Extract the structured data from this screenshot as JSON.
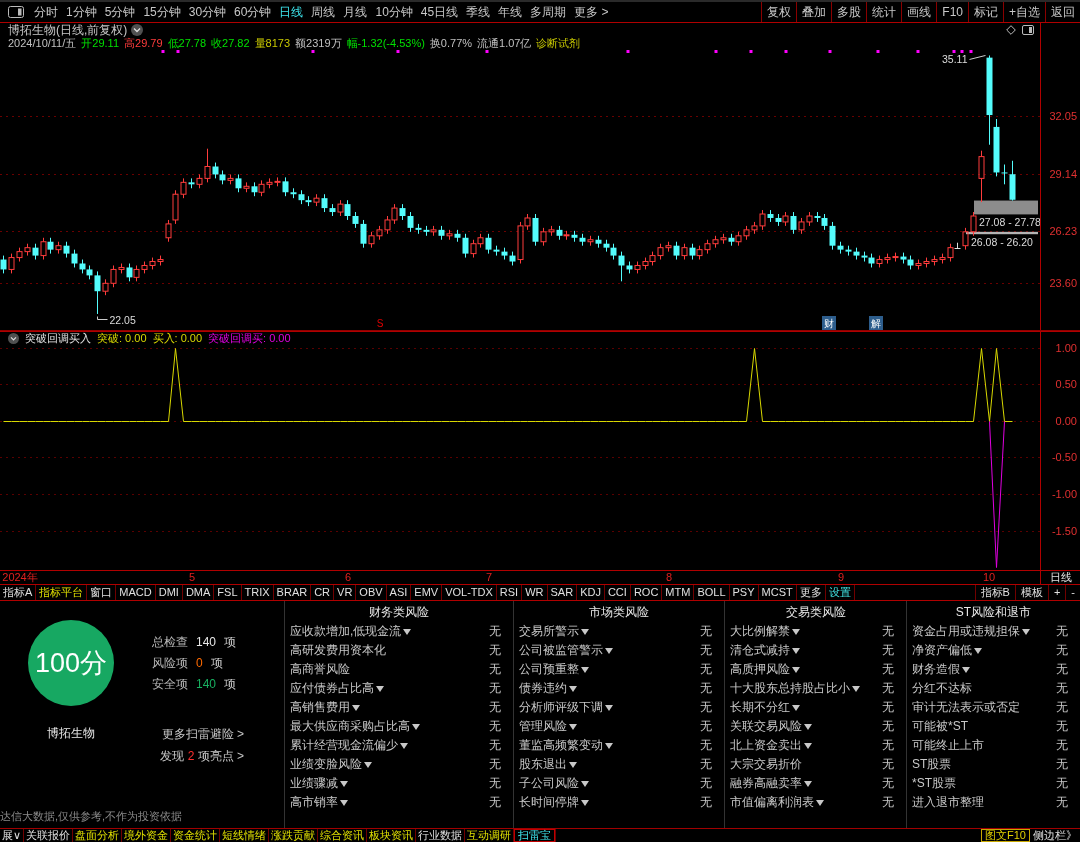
{
  "toolbar": {
    "periods": [
      {
        "label": "分时",
        "selected": false
      },
      {
        "label": "1分钟",
        "selected": false
      },
      {
        "label": "5分钟",
        "selected": false
      },
      {
        "label": "15分钟",
        "selected": false
      },
      {
        "label": "30分钟",
        "selected": false
      },
      {
        "label": "60分钟",
        "selected": false
      },
      {
        "label": "日线",
        "selected": true
      },
      {
        "label": "周线",
        "selected": false
      },
      {
        "label": "月线",
        "selected": false
      },
      {
        "label": "10分钟",
        "selected": false
      },
      {
        "label": "45日线",
        "selected": false
      },
      {
        "label": "季线",
        "selected": false
      },
      {
        "label": "年线",
        "selected": false
      },
      {
        "label": "多周期",
        "selected": false
      },
      {
        "label": "更多 >",
        "selected": false
      }
    ],
    "buttons": [
      "复权",
      "叠加",
      "多股",
      "统计",
      "画线",
      "F10",
      "标记",
      "+自选",
      "返回"
    ]
  },
  "quote": {
    "title": "博拓生物(日线,前复权)",
    "fields": [
      {
        "text": "2024/10/11/五",
        "kind": "plain"
      },
      {
        "text": "开29.11",
        "kind": "down"
      },
      {
        "text": "高29.79",
        "kind": "up"
      },
      {
        "text": "低27.78",
        "kind": "down"
      },
      {
        "text": "收27.82",
        "kind": "down"
      },
      {
        "text": "量8173",
        "kind": "volume"
      },
      {
        "text": "额2319万",
        "kind": "plain"
      },
      {
        "text": "幅-1.32(-4.53%)",
        "kind": "down"
      },
      {
        "text": "换0.77%",
        "kind": "plain"
      },
      {
        "text": "流通1.07亿",
        "kind": "plain"
      },
      {
        "text": "诊断试剂",
        "kind": "sector"
      }
    ]
  },
  "price_chart": {
    "chart_data": {
      "type": "candlestick",
      "grid": true,
      "categories": [
        null,
        null,
        null,
        null,
        null,
        null,
        null,
        null,
        null,
        null,
        null,
        null,
        null,
        null,
        null,
        null,
        null,
        null,
        null,
        null,
        null,
        null,
        null,
        null,
        null,
        null,
        null,
        null,
        null,
        null,
        null,
        null,
        null,
        null,
        null,
        null,
        null,
        null,
        null,
        null,
        null,
        null,
        null,
        null,
        null,
        null,
        null,
        null,
        null,
        null,
        null,
        null,
        null,
        null,
        null,
        null,
        null,
        null,
        null,
        null,
        null,
        null,
        null,
        null,
        null,
        null,
        null,
        null,
        null,
        null,
        null,
        null,
        null,
        null,
        null,
        null,
        null,
        null,
        null,
        null,
        null,
        null,
        null,
        null,
        null,
        null,
        null,
        null,
        null,
        null,
        null,
        null,
        null,
        null,
        null,
        null,
        null,
        null,
        null,
        null,
        null,
        null,
        null,
        null,
        null,
        null,
        null,
        null,
        null,
        null,
        null,
        null,
        null,
        null,
        null,
        null,
        null,
        null,
        null,
        null,
        null,
        null,
        null,
        null,
        null,
        null,
        null,
        null,
        null,
        null,
        null,
        null,
        null
      ],
      "ohlc": [
        [
          24.8,
          25.0,
          24.1,
          24.3
        ],
        [
          24.3,
          25.1,
          24.1,
          24.9
        ],
        [
          24.9,
          25.4,
          24.7,
          25.2
        ],
        [
          25.2,
          25.6,
          25.0,
          25.4
        ],
        [
          25.4,
          25.6,
          24.8,
          25.0
        ],
        [
          25.0,
          25.9,
          24.8,
          25.7
        ],
        [
          25.7,
          25.9,
          25.1,
          25.3
        ],
        [
          25.3,
          25.7,
          25.1,
          25.5
        ],
        [
          25.5,
          25.7,
          24.9,
          25.1
        ],
        [
          25.1,
          25.3,
          24.4,
          24.6
        ],
        [
          24.6,
          24.8,
          24.1,
          24.3
        ],
        [
          24.3,
          24.5,
          23.8,
          24.0
        ],
        [
          24.0,
          24.2,
          22.05,
          23.2
        ],
        [
          23.2,
          23.8,
          23.0,
          23.6
        ],
        [
          23.6,
          24.5,
          23.4,
          24.3
        ],
        [
          24.3,
          24.6,
          24.1,
          24.4
        ],
        [
          24.4,
          24.6,
          23.7,
          23.9
        ],
        [
          23.9,
          24.5,
          23.7,
          24.3
        ],
        [
          24.3,
          24.7,
          24.1,
          24.5
        ],
        [
          24.5,
          24.9,
          24.3,
          24.7
        ],
        [
          24.7,
          25.0,
          24.5,
          24.8
        ],
        [
          25.9,
          26.8,
          25.7,
          26.6
        ],
        [
          26.8,
          28.3,
          26.6,
          28.1
        ],
        [
          28.1,
          28.9,
          27.9,
          28.7
        ],
        [
          28.7,
          28.9,
          28.4,
          28.6
        ],
        [
          28.6,
          29.1,
          28.4,
          28.9
        ],
        [
          28.9,
          30.4,
          28.7,
          29.5
        ],
        [
          29.5,
          29.7,
          28.9,
          29.1
        ],
        [
          29.1,
          29.3,
          28.6,
          28.8
        ],
        [
          28.8,
          29.1,
          28.6,
          28.9
        ],
        [
          28.9,
          29.1,
          28.2,
          28.4
        ],
        [
          28.4,
          28.7,
          28.2,
          28.5
        ],
        [
          28.5,
          28.7,
          28.0,
          28.2
        ],
        [
          28.2,
          28.8,
          28.0,
          28.6
        ],
        [
          28.6,
          28.9,
          28.4,
          28.7
        ],
        [
          28.7,
          28.95,
          28.5,
          28.75
        ],
        [
          28.75,
          28.95,
          28.0,
          28.2
        ],
        [
          28.2,
          28.4,
          27.9,
          28.1
        ],
        [
          28.1,
          28.3,
          27.6,
          27.8
        ],
        [
          27.8,
          28.0,
          27.5,
          27.7
        ],
        [
          27.7,
          28.1,
          27.5,
          27.9
        ],
        [
          27.9,
          28.1,
          27.2,
          27.4
        ],
        [
          27.4,
          27.6,
          27.0,
          27.2
        ],
        [
          27.2,
          27.8,
          27.0,
          27.6
        ],
        [
          27.6,
          27.8,
          26.8,
          27.0
        ],
        [
          27.0,
          27.2,
          26.4,
          26.6
        ],
        [
          26.6,
          26.8,
          25.4,
          25.6
        ],
        [
          25.6,
          26.2,
          25.4,
          26.0
        ],
        [
          26.0,
          26.5,
          25.8,
          26.3
        ],
        [
          26.3,
          27.0,
          26.1,
          26.8
        ],
        [
          26.8,
          27.6,
          26.6,
          27.4
        ],
        [
          27.4,
          27.6,
          26.8,
          27.0
        ],
        [
          27.0,
          27.2,
          26.2,
          26.4
        ],
        [
          26.4,
          26.6,
          26.1,
          26.3
        ],
        [
          26.3,
          26.5,
          26.0,
          26.2
        ],
        [
          26.2,
          26.5,
          26.0,
          26.3
        ],
        [
          26.3,
          26.5,
          25.8,
          26.0
        ],
        [
          26.0,
          26.3,
          25.8,
          26.1
        ],
        [
          26.1,
          26.3,
          25.7,
          25.9
        ],
        [
          25.9,
          26.1,
          24.9,
          25.1
        ],
        [
          25.1,
          25.8,
          24.9,
          25.6
        ],
        [
          25.6,
          26.1,
          25.4,
          25.9
        ],
        [
          25.9,
          26.1,
          25.1,
          25.3
        ],
        [
          25.3,
          25.5,
          25.0,
          25.2
        ],
        [
          25.2,
          25.4,
          24.8,
          25.0
        ],
        [
          25.0,
          25.2,
          24.5,
          24.7
        ],
        [
          24.8,
          26.7,
          24.6,
          26.5
        ],
        [
          26.5,
          27.1,
          26.3,
          26.9
        ],
        [
          26.9,
          27.1,
          25.5,
          25.7
        ],
        [
          25.7,
          26.4,
          25.5,
          26.2
        ],
        [
          26.2,
          26.5,
          26.0,
          26.3
        ],
        [
          26.3,
          26.5,
          25.8,
          26.0
        ],
        [
          26.0,
          26.25,
          25.8,
          26.05
        ],
        [
          26.05,
          26.25,
          25.7,
          25.9
        ],
        [
          25.9,
          26.1,
          25.5,
          25.7
        ],
        [
          25.7,
          26.0,
          25.5,
          25.8
        ],
        [
          25.8,
          26.0,
          25.4,
          25.6
        ],
        [
          25.6,
          25.8,
          25.2,
          25.4
        ],
        [
          25.4,
          25.6,
          24.8,
          25.0
        ],
        [
          25.0,
          25.2,
          23.7,
          24.5
        ],
        [
          24.5,
          24.7,
          24.1,
          24.3
        ],
        [
          24.3,
          24.7,
          24.1,
          24.5
        ],
        [
          24.5,
          24.9,
          24.3,
          24.7
        ],
        [
          24.7,
          25.2,
          24.5,
          25.0
        ],
        [
          25.0,
          25.6,
          24.8,
          25.4
        ],
        [
          25.4,
          25.7,
          25.2,
          25.5
        ],
        [
          25.5,
          25.7,
          24.8,
          25.0
        ],
        [
          25.0,
          25.6,
          24.8,
          25.4
        ],
        [
          25.4,
          25.6,
          24.8,
          25.0
        ],
        [
          25.0,
          25.5,
          24.8,
          25.3
        ],
        [
          25.3,
          25.8,
          25.1,
          25.6
        ],
        [
          25.6,
          26.0,
          25.4,
          25.8
        ],
        [
          25.8,
          26.1,
          25.6,
          25.9
        ],
        [
          25.9,
          26.1,
          25.5,
          25.7
        ],
        [
          25.7,
          26.2,
          25.5,
          26.0
        ],
        [
          26.0,
          26.5,
          25.8,
          26.3
        ],
        [
          26.3,
          26.7,
          26.1,
          26.5
        ],
        [
          26.5,
          27.3,
          26.3,
          27.1
        ],
        [
          27.1,
          27.3,
          26.7,
          26.9
        ],
        [
          26.9,
          27.1,
          26.5,
          26.7
        ],
        [
          26.7,
          27.2,
          26.5,
          27.0
        ],
        [
          27.0,
          27.2,
          26.1,
          26.3
        ],
        [
          26.3,
          26.9,
          26.1,
          26.7
        ],
        [
          26.7,
          27.2,
          26.5,
          27.0
        ],
        [
          27.0,
          27.2,
          26.7,
          26.9
        ],
        [
          26.9,
          27.1,
          26.3,
          26.5
        ],
        [
          26.5,
          26.7,
          25.3,
          25.5
        ],
        [
          25.5,
          25.7,
          25.1,
          25.3
        ],
        [
          25.3,
          25.5,
          25.0,
          25.2
        ],
        [
          25.2,
          25.4,
          24.8,
          25.0
        ],
        [
          25.0,
          25.2,
          24.7,
          24.9
        ],
        [
          24.9,
          25.1,
          24.4,
          24.6
        ],
        [
          24.6,
          25.0,
          24.4,
          24.8
        ],
        [
          24.8,
          25.1,
          24.6,
          24.9
        ],
        [
          24.9,
          25.15,
          24.7,
          24.95
        ],
        [
          24.95,
          25.15,
          24.6,
          24.8
        ],
        [
          24.8,
          25.0,
          24.3,
          24.5
        ],
        [
          24.5,
          24.8,
          24.3,
          24.6
        ],
        [
          24.6,
          24.9,
          24.4,
          24.7
        ],
        [
          24.7,
          25.0,
          24.5,
          24.8
        ],
        [
          24.8,
          25.1,
          24.6,
          24.9
        ],
        [
          24.9,
          25.6,
          24.7,
          25.4
        ],
        [
          25.4,
          25.65,
          25.4,
          25.4
        ],
        [
          25.5,
          26.4,
          25.3,
          26.2
        ],
        [
          26.2,
          27.2,
          26.0,
          27.0
        ],
        [
          28.9,
          30.3,
          27.7,
          30.0
        ],
        [
          35.0,
          35.11,
          30.6,
          32.1
        ],
        [
          31.5,
          31.9,
          29.0,
          29.2
        ],
        [
          29.2,
          29.6,
          28.6,
          29.15
        ],
        [
          29.11,
          29.79,
          27.78,
          27.82
        ],
        null,
        null,
        null
      ],
      "ylim": [
        21.19,
        36.75
      ],
      "yticks": [
        {
          "value": 32.05,
          "label": "32.05"
        },
        {
          "value": 29.14,
          "label": "29.14"
        },
        {
          "value": 26.23,
          "label": "26.23"
        },
        {
          "value": 23.6,
          "label": "23.60"
        }
      ],
      "bands": [
        {
          "axis": "y",
          "from": 27.08,
          "to": 27.78,
          "label": "27.08 - 27.78"
        },
        {
          "axis": "y",
          "from": 26.08,
          "to": 26.2,
          "label": "26.08 - 26.20"
        }
      ],
      "annotations": [
        "22.05",
        "35.11"
      ]
    },
    "markers": [
      {
        "kind": "signal",
        "text": "S"
      },
      {
        "kind": "badge",
        "text": "财"
      },
      {
        "kind": "badge",
        "text": "解"
      }
    ]
  },
  "indicator": {
    "name": "突破回调买入",
    "readings": [
      ": 0.00",
      ": 0.00",
      ": 0.00"
    ],
    "chart_data": {
      "type": "line",
      "grid": true,
      "categories": [
        null,
        null,
        "2024年",
        null,
        null,
        null,
        null,
        null,
        null,
        null,
        null,
        null,
        null,
        null,
        null,
        null,
        null,
        null,
        null,
        null,
        null,
        null,
        null,
        null,
        "5",
        null,
        null,
        null,
        null,
        null,
        null,
        null,
        null,
        null,
        null,
        null,
        null,
        null,
        null,
        null,
        null,
        null,
        null,
        null,
        "6",
        null,
        null,
        null,
        null,
        null,
        null,
        null,
        null,
        null,
        null,
        null,
        null,
        null,
        null,
        null,
        null,
        null,
        "7",
        null,
        null,
        null,
        null,
        null,
        null,
        null,
        null,
        null,
        null,
        null,
        null,
        null,
        null,
        null,
        null,
        null,
        null,
        null,
        null,
        null,
        null,
        "8",
        null,
        null,
        null,
        null,
        null,
        null,
        null,
        null,
        null,
        null,
        null,
        null,
        null,
        null,
        null,
        null,
        null,
        null,
        null,
        null,
        null,
        "9",
        null,
        null,
        null,
        null,
        null,
        null,
        null,
        null,
        null,
        null,
        null,
        null,
        null,
        null,
        null,
        null,
        null,
        null,
        "10",
        null,
        null,
        null,
        null,
        null,
        null
      ],
      "ylim": [
        -2.04,
        1.23
      ],
      "yticks": [
        {
          "value": 1,
          "label": "1.00"
        },
        {
          "value": 0.5,
          "label": "0.50"
        },
        {
          "value": 0,
          "label": "0.00"
        },
        {
          "value": -0.5,
          "label": "-0.50"
        },
        {
          "value": -1,
          "label": "-1.00"
        },
        {
          "value": -1.5,
          "label": "-1.50"
        }
      ],
      "series": [
        {
          "name": "突破",
          "color": "#d8d800",
          "values": [
            0,
            0,
            0,
            0,
            0,
            0,
            0,
            0,
            0,
            0,
            0,
            0,
            0,
            0,
            0,
            0,
            0,
            0,
            0,
            0,
            0,
            0,
            1,
            0,
            0,
            0,
            0,
            0,
            0,
            0,
            0,
            0,
            0,
            0,
            0,
            0,
            0,
            0,
            0,
            0,
            0,
            0,
            0,
            0,
            0,
            0,
            0,
            0,
            0,
            0,
            0,
            0,
            0,
            0,
            0,
            0,
            0,
            0,
            0,
            0,
            0,
            0,
            0,
            0,
            0,
            0,
            0,
            0,
            0,
            0,
            0,
            0,
            0,
            0,
            0,
            0,
            0,
            0,
            0,
            0,
            0,
            0,
            0,
            0,
            0,
            0,
            0,
            0,
            0,
            0,
            0,
            0,
            0,
            0,
            0,
            0,
            1,
            0,
            0,
            0,
            0,
            0,
            0,
            0,
            0,
            0,
            0,
            0,
            0,
            0,
            0,
            0,
            0,
            0,
            0,
            0,
            0,
            0,
            0,
            0,
            0,
            0,
            0,
            0,
            0,
            1,
            0,
            1,
            0,
            0,
            null,
            null,
            null
          ]
        },
        {
          "name": "买入",
          "color": "#d8d800",
          "values": [
            null,
            null,
            null,
            null,
            null,
            null,
            null,
            null,
            null,
            null,
            null,
            null,
            null,
            null,
            null,
            null,
            null,
            null,
            null,
            null,
            null,
            null,
            null,
            null,
            null,
            null,
            null,
            null,
            null,
            null,
            null,
            null,
            null,
            null,
            null,
            null,
            null,
            null,
            null,
            null,
            null,
            null,
            null,
            null,
            null,
            null,
            null,
            null,
            null,
            null,
            null,
            null,
            null,
            null,
            null,
            null,
            null,
            null,
            null,
            null,
            null,
            null,
            null,
            null,
            null,
            null,
            null,
            null,
            null,
            null,
            null,
            null,
            null,
            null,
            null,
            null,
            null,
            null,
            null,
            null,
            null,
            null,
            null,
            null,
            null,
            null,
            null,
            null,
            null,
            null,
            null,
            null,
            null,
            null,
            null,
            null,
            null,
            null,
            null,
            null,
            null,
            null,
            null,
            null,
            null,
            null,
            null,
            null,
            null,
            null,
            null,
            null,
            null,
            null,
            null,
            null,
            null,
            null,
            null,
            null,
            null,
            null,
            null,
            null,
            null,
            null,
            null,
            null,
            null,
            null,
            null,
            null,
            null
          ]
        },
        {
          "name": "突破回调买",
          "color": "#e000e0",
          "values": [
            null,
            null,
            null,
            null,
            null,
            null,
            null,
            null,
            null,
            null,
            null,
            null,
            null,
            null,
            null,
            null,
            null,
            null,
            null,
            null,
            null,
            null,
            null,
            null,
            null,
            null,
            null,
            null,
            null,
            null,
            null,
            null,
            null,
            null,
            null,
            null,
            null,
            null,
            null,
            null,
            null,
            null,
            null,
            null,
            null,
            null,
            null,
            null,
            null,
            null,
            null,
            null,
            null,
            null,
            null,
            null,
            null,
            null,
            null,
            null,
            null,
            null,
            null,
            null,
            null,
            null,
            null,
            null,
            null,
            null,
            null,
            null,
            null,
            null,
            null,
            null,
            null,
            null,
            null,
            null,
            null,
            null,
            null,
            null,
            null,
            null,
            null,
            null,
            null,
            null,
            null,
            null,
            null,
            null,
            null,
            null,
            null,
            null,
            null,
            null,
            null,
            null,
            null,
            null,
            null,
            null,
            null,
            null,
            null,
            null,
            null,
            null,
            null,
            null,
            null,
            null,
            null,
            null,
            null,
            null,
            null,
            null,
            null,
            null,
            null,
            null,
            0,
            -2,
            0,
            null,
            null,
            null,
            null
          ]
        }
      ]
    }
  },
  "period_label": "日线",
  "indicator_tabs": {
    "left": [
      {
        "label": "指标A",
        "kind": "plain"
      },
      {
        "label": "指标平台",
        "kind": "platform"
      },
      {
        "label": "窗口",
        "kind": "plain"
      },
      {
        "label": "MACD",
        "kind": "plain"
      },
      {
        "label": "DMI",
        "kind": "plain"
      },
      {
        "label": "DMA",
        "kind": "plain"
      },
      {
        "label": "FSL",
        "kind": "plain"
      },
      {
        "label": "TRIX",
        "kind": "plain"
      },
      {
        "label": "BRAR",
        "kind": "plain"
      },
      {
        "label": "CR",
        "kind": "plain"
      },
      {
        "label": "VR",
        "kind": "plain"
      },
      {
        "label": "OBV",
        "kind": "plain"
      },
      {
        "label": "ASI",
        "kind": "plain"
      },
      {
        "label": "EMV",
        "kind": "plain"
      },
      {
        "label": "VOL-TDX",
        "kind": "plain"
      },
      {
        "label": "RSI",
        "kind": "plain"
      },
      {
        "label": "WR",
        "kind": "plain"
      },
      {
        "label": "SAR",
        "kind": "plain"
      },
      {
        "label": "KDJ",
        "kind": "plain"
      },
      {
        "label": "CCI",
        "kind": "plain"
      },
      {
        "label": "ROC",
        "kind": "plain"
      },
      {
        "label": "MTM",
        "kind": "plain"
      },
      {
        "label": "BOLL",
        "kind": "plain"
      },
      {
        "label": "PSY",
        "kind": "plain"
      },
      {
        "label": "MCST",
        "kind": "plain"
      },
      {
        "label": "更多",
        "kind": "plain"
      },
      {
        "label": "设置",
        "kind": "settings"
      }
    ],
    "right": [
      "指标B",
      "模板",
      "+",
      "-"
    ]
  },
  "scan": {
    "score": "100分",
    "stock": "博拓生物",
    "stats": [
      {
        "label": "总检查",
        "value": "140",
        "unit": "项",
        "kind": "total"
      },
      {
        "label": "风险项",
        "value": "0",
        "unit": "项",
        "kind": "risk"
      },
      {
        "label": "安全项",
        "value": "140",
        "unit": "项",
        "kind": "safe"
      }
    ],
    "more_link": "更多扫雷避险 >",
    "highlights": {
      "prefix": "发现",
      "count": "2",
      "suffix": "项亮点 >"
    },
    "disclaimer": "达信大数据,仅供参考,不作为投资依据",
    "categories": [
      {
        "title": "财务类风险",
        "items": [
          {
            "label": "应收款增加,低现金流",
            "menu": true,
            "value": "无"
          },
          {
            "label": "高研发费用资本化",
            "menu": false,
            "value": "无"
          },
          {
            "label": "高商誉风险",
            "menu": false,
            "value": "无"
          },
          {
            "label": "应付债券占比高",
            "menu": true,
            "value": "无"
          },
          {
            "label": "高销售费用",
            "menu": true,
            "value": "无"
          },
          {
            "label": "最大供应商采购占比高",
            "menu": true,
            "value": "无"
          },
          {
            "label": "累计经营现金流偏少",
            "menu": true,
            "value": "无"
          },
          {
            "label": "业绩变脸风险",
            "menu": true,
            "value": "无"
          },
          {
            "label": "业绩骤减",
            "menu": true,
            "value": "无"
          },
          {
            "label": "高市销率",
            "menu": true,
            "value": "无"
          }
        ]
      },
      {
        "title": "市场类风险",
        "items": [
          {
            "label": "交易所警示",
            "menu": true,
            "value": "无"
          },
          {
            "label": "公司被监管警示",
            "menu": true,
            "value": "无"
          },
          {
            "label": "公司预重整",
            "menu": true,
            "value": "无"
          },
          {
            "label": "债券违约",
            "menu": true,
            "value": "无"
          },
          {
            "label": "分析师评级下调",
            "menu": true,
            "value": "无"
          },
          {
            "label": "管理风险",
            "menu": true,
            "value": "无"
          },
          {
            "label": "董监高频繁变动",
            "menu": true,
            "value": "无"
          },
          {
            "label": "股东退出",
            "menu": true,
            "value": "无"
          },
          {
            "label": "子公司风险",
            "menu": true,
            "value": "无"
          },
          {
            "label": "长时间停牌",
            "menu": true,
            "value": "无"
          }
        ]
      },
      {
        "title": "交易类风险",
        "items": [
          {
            "label": "大比例解禁",
            "menu": true,
            "value": "无"
          },
          {
            "label": "清仓式减持",
            "menu": true,
            "value": "无"
          },
          {
            "label": "高质押风险",
            "menu": true,
            "value": "无"
          },
          {
            "label": "十大股东总持股占比小",
            "menu": true,
            "value": "无"
          },
          {
            "label": "长期不分红",
            "menu": true,
            "value": "无"
          },
          {
            "label": "关联交易风险",
            "menu": true,
            "value": "无"
          },
          {
            "label": "北上资金卖出",
            "menu": true,
            "value": "无"
          },
          {
            "label": "大宗交易折价",
            "menu": false,
            "value": "无"
          },
          {
            "label": "融券高融卖率",
            "menu": true,
            "value": "无"
          },
          {
            "label": "市值偏离利润表",
            "menu": true,
            "value": "无"
          }
        ]
      },
      {
        "title": "ST风险和退市",
        "items": [
          {
            "label": "资金占用或违规担保",
            "menu": true,
            "value": "无"
          },
          {
            "label": "净资产偏低",
            "menu": true,
            "value": "无"
          },
          {
            "label": "财务造假",
            "menu": true,
            "value": "无"
          },
          {
            "label": "分红不达标",
            "menu": false,
            "value": "无"
          },
          {
            "label": "审计无法表示或否定",
            "menu": false,
            "value": "无"
          },
          {
            "label": "可能被*ST",
            "menu": false,
            "value": "无"
          },
          {
            "label": "可能终止上市",
            "menu": false,
            "value": "无"
          },
          {
            "label": "ST股票",
            "menu": false,
            "value": "无"
          },
          {
            "label": "*ST股票",
            "menu": false,
            "value": "无"
          },
          {
            "label": "进入退市整理",
            "menu": false,
            "value": "无"
          }
        ]
      }
    ]
  },
  "bottom_tabs": [
    {
      "label": "展∨",
      "kind": "plain",
      "selected": false
    },
    {
      "label": "关联报价",
      "kind": "plain",
      "selected": false
    },
    {
      "label": "盘面分析",
      "kind": "feature",
      "selected": false
    },
    {
      "label": "境外资金",
      "kind": "feature",
      "selected": false
    },
    {
      "label": "资金统计",
      "kind": "feature",
      "selected": false
    },
    {
      "label": "短线情绪",
      "kind": "feature",
      "selected": false
    },
    {
      "label": "涨跌贡献",
      "kind": "feature",
      "selected": false
    },
    {
      "label": "综合资讯",
      "kind": "feature",
      "selected": false
    },
    {
      "label": "板块资讯",
      "kind": "feature",
      "selected": false
    },
    {
      "label": "行业数据",
      "kind": "plain",
      "selected": false
    },
    {
      "label": "互动调研",
      "kind": "feature",
      "selected": false
    },
    {
      "label": "扫雷宝",
      "kind": "feature",
      "selected": true
    }
  ],
  "side_buttons": [
    {
      "label": "图文F10",
      "kind": "boxed"
    },
    {
      "label": "侧边栏》",
      "kind": "plain"
    }
  ]
}
